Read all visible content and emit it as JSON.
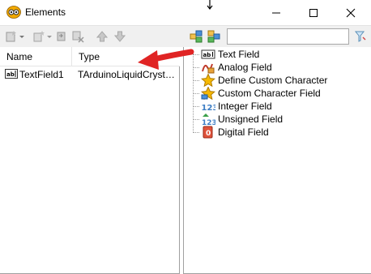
{
  "window": {
    "title": "Elements",
    "minimize_icon": "minimize-icon",
    "maximize_icon": "maximize-icon",
    "close_icon": "close-icon"
  },
  "toolbar": {
    "buttons": [
      "new-element-icon",
      "new-element-dropdown-icon",
      "copy-element-icon",
      "delete-element-icon",
      "move-up-icon",
      "move-down-icon"
    ],
    "right_buttons": [
      "expand-all-icon",
      "collapse-all-icon"
    ],
    "search": {
      "value": "",
      "placeholder": ""
    },
    "clear_icon": "clear-search-icon"
  },
  "elements_table": {
    "columns": [
      "Name",
      "Type"
    ],
    "rows": [
      {
        "name": "TextField1",
        "type": "TArduinoLiquidCrystalElementTextField"
      }
    ]
  },
  "palette": {
    "items": [
      {
        "label": "Text Field",
        "icon": "text-field-icon"
      },
      {
        "label": "Analog Field",
        "icon": "analog-field-icon"
      },
      {
        "label": "Define Custom Character",
        "icon": "define-custom-character-icon"
      },
      {
        "label": "Custom Character Field",
        "icon": "custom-character-field-icon"
      },
      {
        "label": "Integer Field",
        "icon": "integer-field-icon"
      },
      {
        "label": "Unsigned Field",
        "icon": "unsigned-field-icon"
      },
      {
        "label": "Digital Field",
        "icon": "digital-field-icon"
      }
    ]
  },
  "colors": {
    "annotation_arrow": "#e02424",
    "panel_border": "#a0a0a0",
    "toolbar_bg": "#f0f0f0"
  }
}
